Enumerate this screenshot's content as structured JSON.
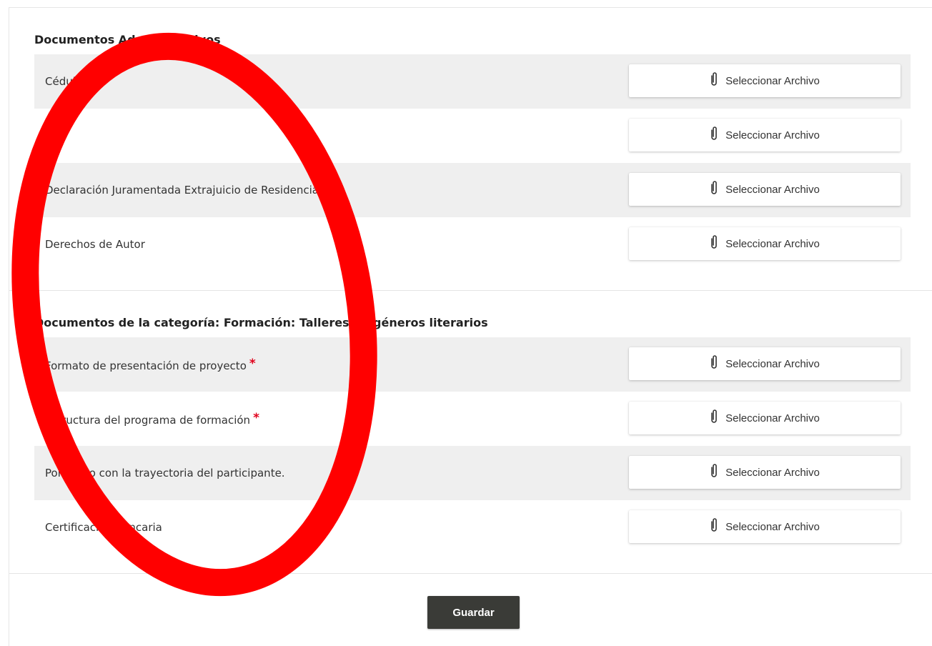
{
  "sections": [
    {
      "title": "Documentos Administrativos",
      "rows": [
        {
          "label": "Cédula",
          "required": false
        },
        {
          "label": "RUT",
          "required": false
        },
        {
          "label": "Declaración Juramentada Extrajuicio de Residencia",
          "required": false
        },
        {
          "label": "Derechos de Autor",
          "required": false
        }
      ]
    },
    {
      "title": "Documentos de la categoría: Formación: Talleres de géneros literarios",
      "rows": [
        {
          "label": "Formato de presentación de proyecto",
          "required": true
        },
        {
          "label": "Estructura del programa de formación",
          "required": true
        },
        {
          "label": "Portafolio con la trayectoria del participante.",
          "required": false
        },
        {
          "label": "Certificación bancaria",
          "required": false
        }
      ]
    }
  ],
  "file_button_label": "Seleccionar Archivo",
  "file_button_icon": "paperclip-icon",
  "required_marker": "*",
  "save_label": "Guardar",
  "colors": {
    "row_shade": "#efefef",
    "required": "#e0001b",
    "save_button_bg": "#3a3b37",
    "annotation_circle": "#ff0000"
  }
}
